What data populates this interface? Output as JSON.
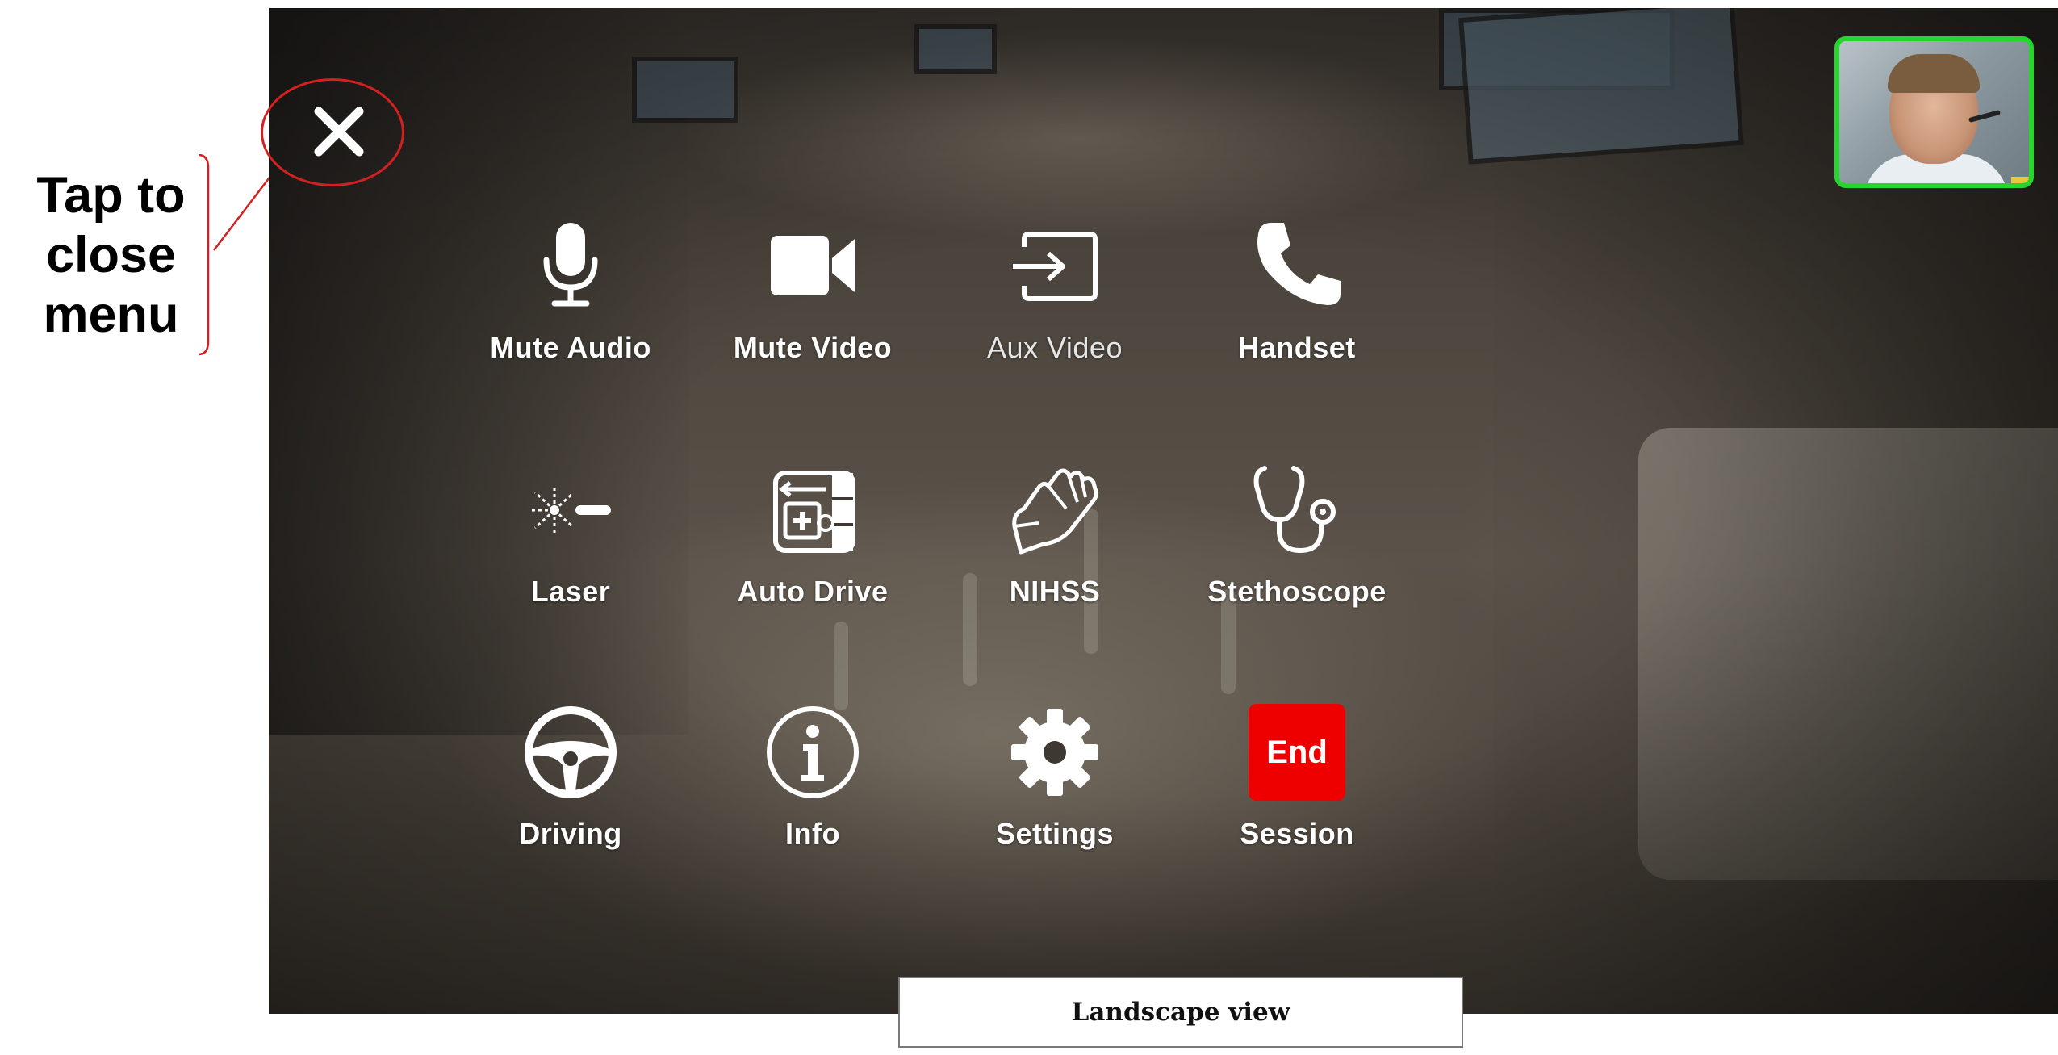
{
  "annotation": {
    "lines": [
      "Tap to",
      "close",
      "menu"
    ],
    "color": "#d42020"
  },
  "close_button": {
    "icon": "close-icon"
  },
  "self_view": {
    "border_color": "#27d62d"
  },
  "menu": {
    "items": [
      {
        "label": "Mute Audio",
        "icon": "microphone-icon"
      },
      {
        "label": "Mute Video",
        "icon": "video-camera-icon"
      },
      {
        "label": "Aux Video",
        "icon": "aux-input-icon"
      },
      {
        "label": "Handset",
        "icon": "phone-handset-icon"
      },
      {
        "label": "Laser",
        "icon": "laser-pointer-icon"
      },
      {
        "label": "Auto Drive",
        "icon": "auto-drive-icon"
      },
      {
        "label": "NIHSS",
        "icon": "glove-icon"
      },
      {
        "label": "Stethoscope",
        "icon": "stethoscope-icon"
      },
      {
        "label": "Driving",
        "icon": "steering-wheel-icon"
      },
      {
        "label": "Info",
        "icon": "info-icon"
      },
      {
        "label": "Settings",
        "icon": "gear-icon"
      },
      {
        "label": "Session",
        "icon": "end-session-icon",
        "badge": "End",
        "badge_color": "#ee0000"
      }
    ]
  },
  "caption": "Landscape view"
}
